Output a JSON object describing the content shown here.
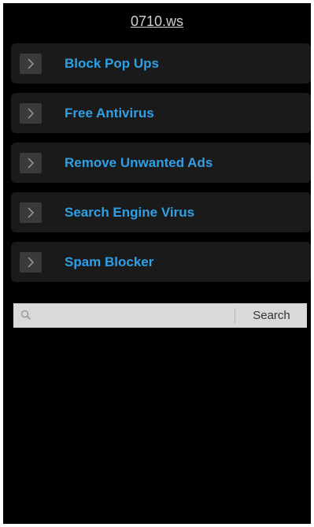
{
  "header": {
    "site_title": "0710.ws"
  },
  "menu": {
    "items": [
      {
        "label": "Block Pop Ups"
      },
      {
        "label": "Free Antivirus"
      },
      {
        "label": "Remove Unwanted Ads"
      },
      {
        "label": "Search Engine Virus"
      },
      {
        "label": "Spam Blocker"
      }
    ]
  },
  "search": {
    "placeholder": "",
    "value": "",
    "button_label": "Search"
  },
  "colors": {
    "background": "#000000",
    "item_background": "#1a1a1a",
    "link": "#2f9fe6",
    "title": "#cfcfcf",
    "search_bar": "#d9d9d9"
  }
}
